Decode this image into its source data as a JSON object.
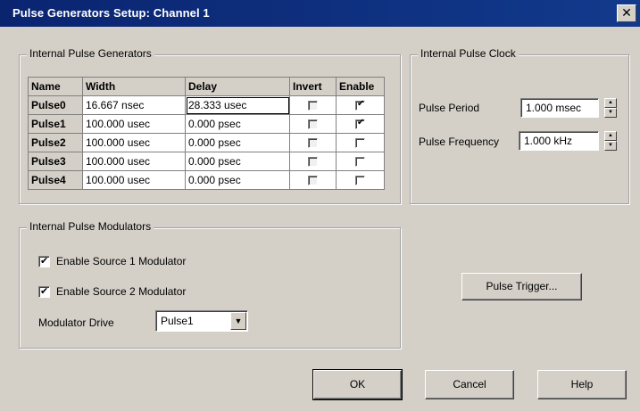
{
  "window": {
    "title": "Pulse Generators Setup: Channel 1",
    "close_glyph": "✕"
  },
  "generators": {
    "title": "Internal Pulse Generators",
    "columns": [
      "Name",
      "Width",
      "Delay",
      "Invert",
      "Enable"
    ],
    "rows": [
      {
        "name": "Pulse0",
        "width": "16.667 nsec",
        "delay": "28.333 usec",
        "invert": false,
        "enable": true
      },
      {
        "name": "Pulse1",
        "width": "100.000 usec",
        "delay": "0.000 psec",
        "invert": false,
        "enable": true
      },
      {
        "name": "Pulse2",
        "width": "100.000 usec",
        "delay": "0.000 psec",
        "invert": false,
        "enable": false
      },
      {
        "name": "Pulse3",
        "width": "100.000 usec",
        "delay": "0.000 psec",
        "invert": false,
        "enable": false
      },
      {
        "name": "Pulse4",
        "width": "100.000 usec",
        "delay": "0.000 psec",
        "invert": false,
        "enable": false
      }
    ]
  },
  "clock": {
    "title": "Internal Pulse Clock",
    "period_label": "Pulse Period",
    "period_value": "1.000 msec",
    "frequency_label": "Pulse Frequency",
    "frequency_value": "1.000 kHz"
  },
  "modulators": {
    "title": "Internal Pulse Modulators",
    "source1_label": "Enable Source 1 Modulator",
    "source1_checked": true,
    "source2_label": "Enable Source 2 Modulator",
    "source2_checked": true,
    "drive_label": "Modulator Drive",
    "drive_value": "Pulse1"
  },
  "buttons": {
    "pulse_trigger": "Pulse Trigger...",
    "ok": "OK",
    "cancel": "Cancel",
    "help": "Help"
  }
}
